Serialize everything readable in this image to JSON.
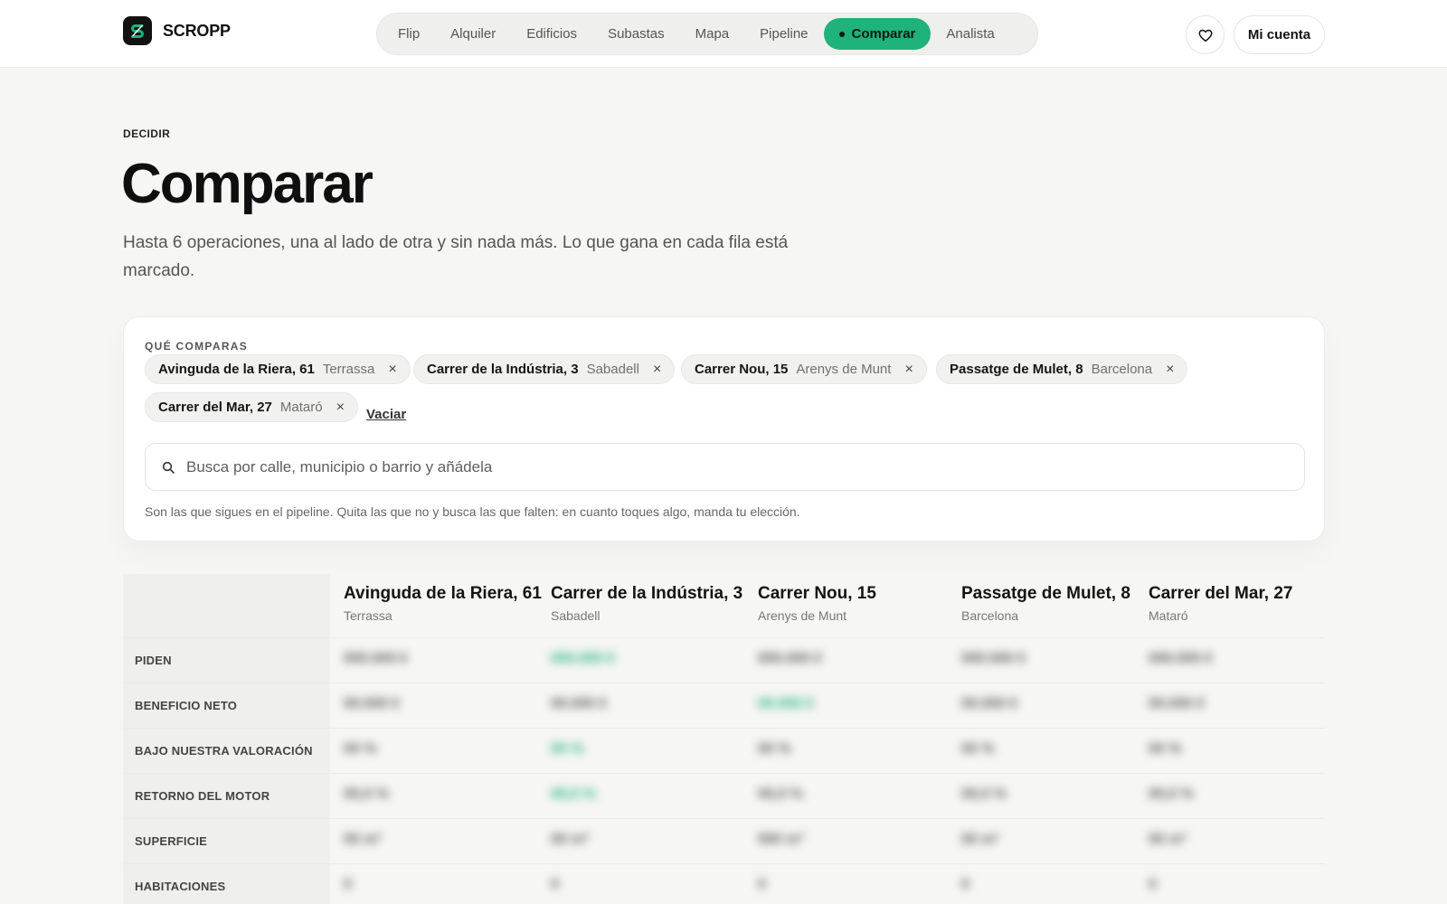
{
  "brand": {
    "name": "SCROPP",
    "logo_glyph": "S"
  },
  "nav": {
    "items": [
      {
        "label": "Flip",
        "active": false
      },
      {
        "label": "Alquiler",
        "active": false
      },
      {
        "label": "Edificios",
        "active": false
      },
      {
        "label": "Subastas",
        "active": false
      },
      {
        "label": "Mapa",
        "active": false
      },
      {
        "label": "Pipeline",
        "active": false
      },
      {
        "label": "Comparar",
        "active": true
      },
      {
        "label": "Analista",
        "active": false
      }
    ]
  },
  "header": {
    "favorites_icon": "heart-icon",
    "account_label": "Mi cuenta"
  },
  "hero": {
    "eyebrow": "DECIDIR",
    "title": "Comparar",
    "lede": "Hasta 6 operaciones, una al lado de otra y sin nada más. Lo que gana en cada fila está marcado."
  },
  "selection": {
    "label": "QUÉ COMPARAS",
    "chips": [
      {
        "street": "Avinguda de la Riera, 61",
        "town": "Terrassa"
      },
      {
        "street": "Carrer de la Indústria, 3",
        "town": "Sabadell"
      },
      {
        "street": "Carrer Nou, 15",
        "town": "Arenys de Munt"
      },
      {
        "street": "Passatge de Mulet, 8",
        "town": "Barcelona"
      },
      {
        "street": "Carrer del Mar, 27",
        "town": "Mataró"
      }
    ],
    "remove_glyph": "×",
    "clear_label": "Vaciar",
    "search_placeholder": "Busca por calle, municipio o barrio y añádela",
    "search_value": "",
    "hint": "Son las que sigues en el pipeline. Quita las que no y busca las que falten: en cuanto toques algo, manda tu elección."
  },
  "comparison": {
    "columns": [
      {
        "street": "Avinguda de la Riera, 61",
        "town": "Terrassa"
      },
      {
        "street": "Carrer de la Indústria, 3",
        "town": "Sabadell"
      },
      {
        "street": "Carrer Nou, 15",
        "town": "Arenys de Munt"
      },
      {
        "street": "Passatge de Mulet, 8",
        "town": "Barcelona"
      },
      {
        "street": "Carrer del Mar, 27",
        "town": "Mataró"
      }
    ],
    "rows": [
      {
        "label": "PIDEN",
        "winner_index": 1,
        "cells": [
          "000.000 €",
          "000.000 €",
          "000.000 €",
          "000.000 €",
          "000.000 €"
        ]
      },
      {
        "label": "BENEFICIO NETO",
        "winner_index": 2,
        "cells": [
          "00.000 €",
          "00.000 €",
          "00.000 €",
          "00.000 €",
          "00.000 €"
        ]
      },
      {
        "label": "BAJO NUESTRA VALORACIÓN",
        "winner_index": 1,
        "cells": [
          "00 %",
          "00 %",
          "00 %",
          "00 %",
          "00 %"
        ]
      },
      {
        "label": "RETORNO DEL MOTOR",
        "winner_index": 1,
        "cells": [
          "00,0 %",
          "00,0 %",
          "00,0 %",
          "00,0 %",
          "00,0 %"
        ]
      },
      {
        "label": "SUPERFICIE",
        "winner_index": -1,
        "cells": [
          "00 m²",
          "00 m²",
          "000 m²",
          "00 m²",
          "00 m²"
        ]
      },
      {
        "label": "HABITACIONES",
        "winner_index": -1,
        "cells": [
          "0",
          "0",
          "0",
          "0",
          "0"
        ]
      }
    ]
  },
  "colors": {
    "accent": "#1fb27a",
    "background": "#f6f6f5",
    "text": "#111111"
  }
}
